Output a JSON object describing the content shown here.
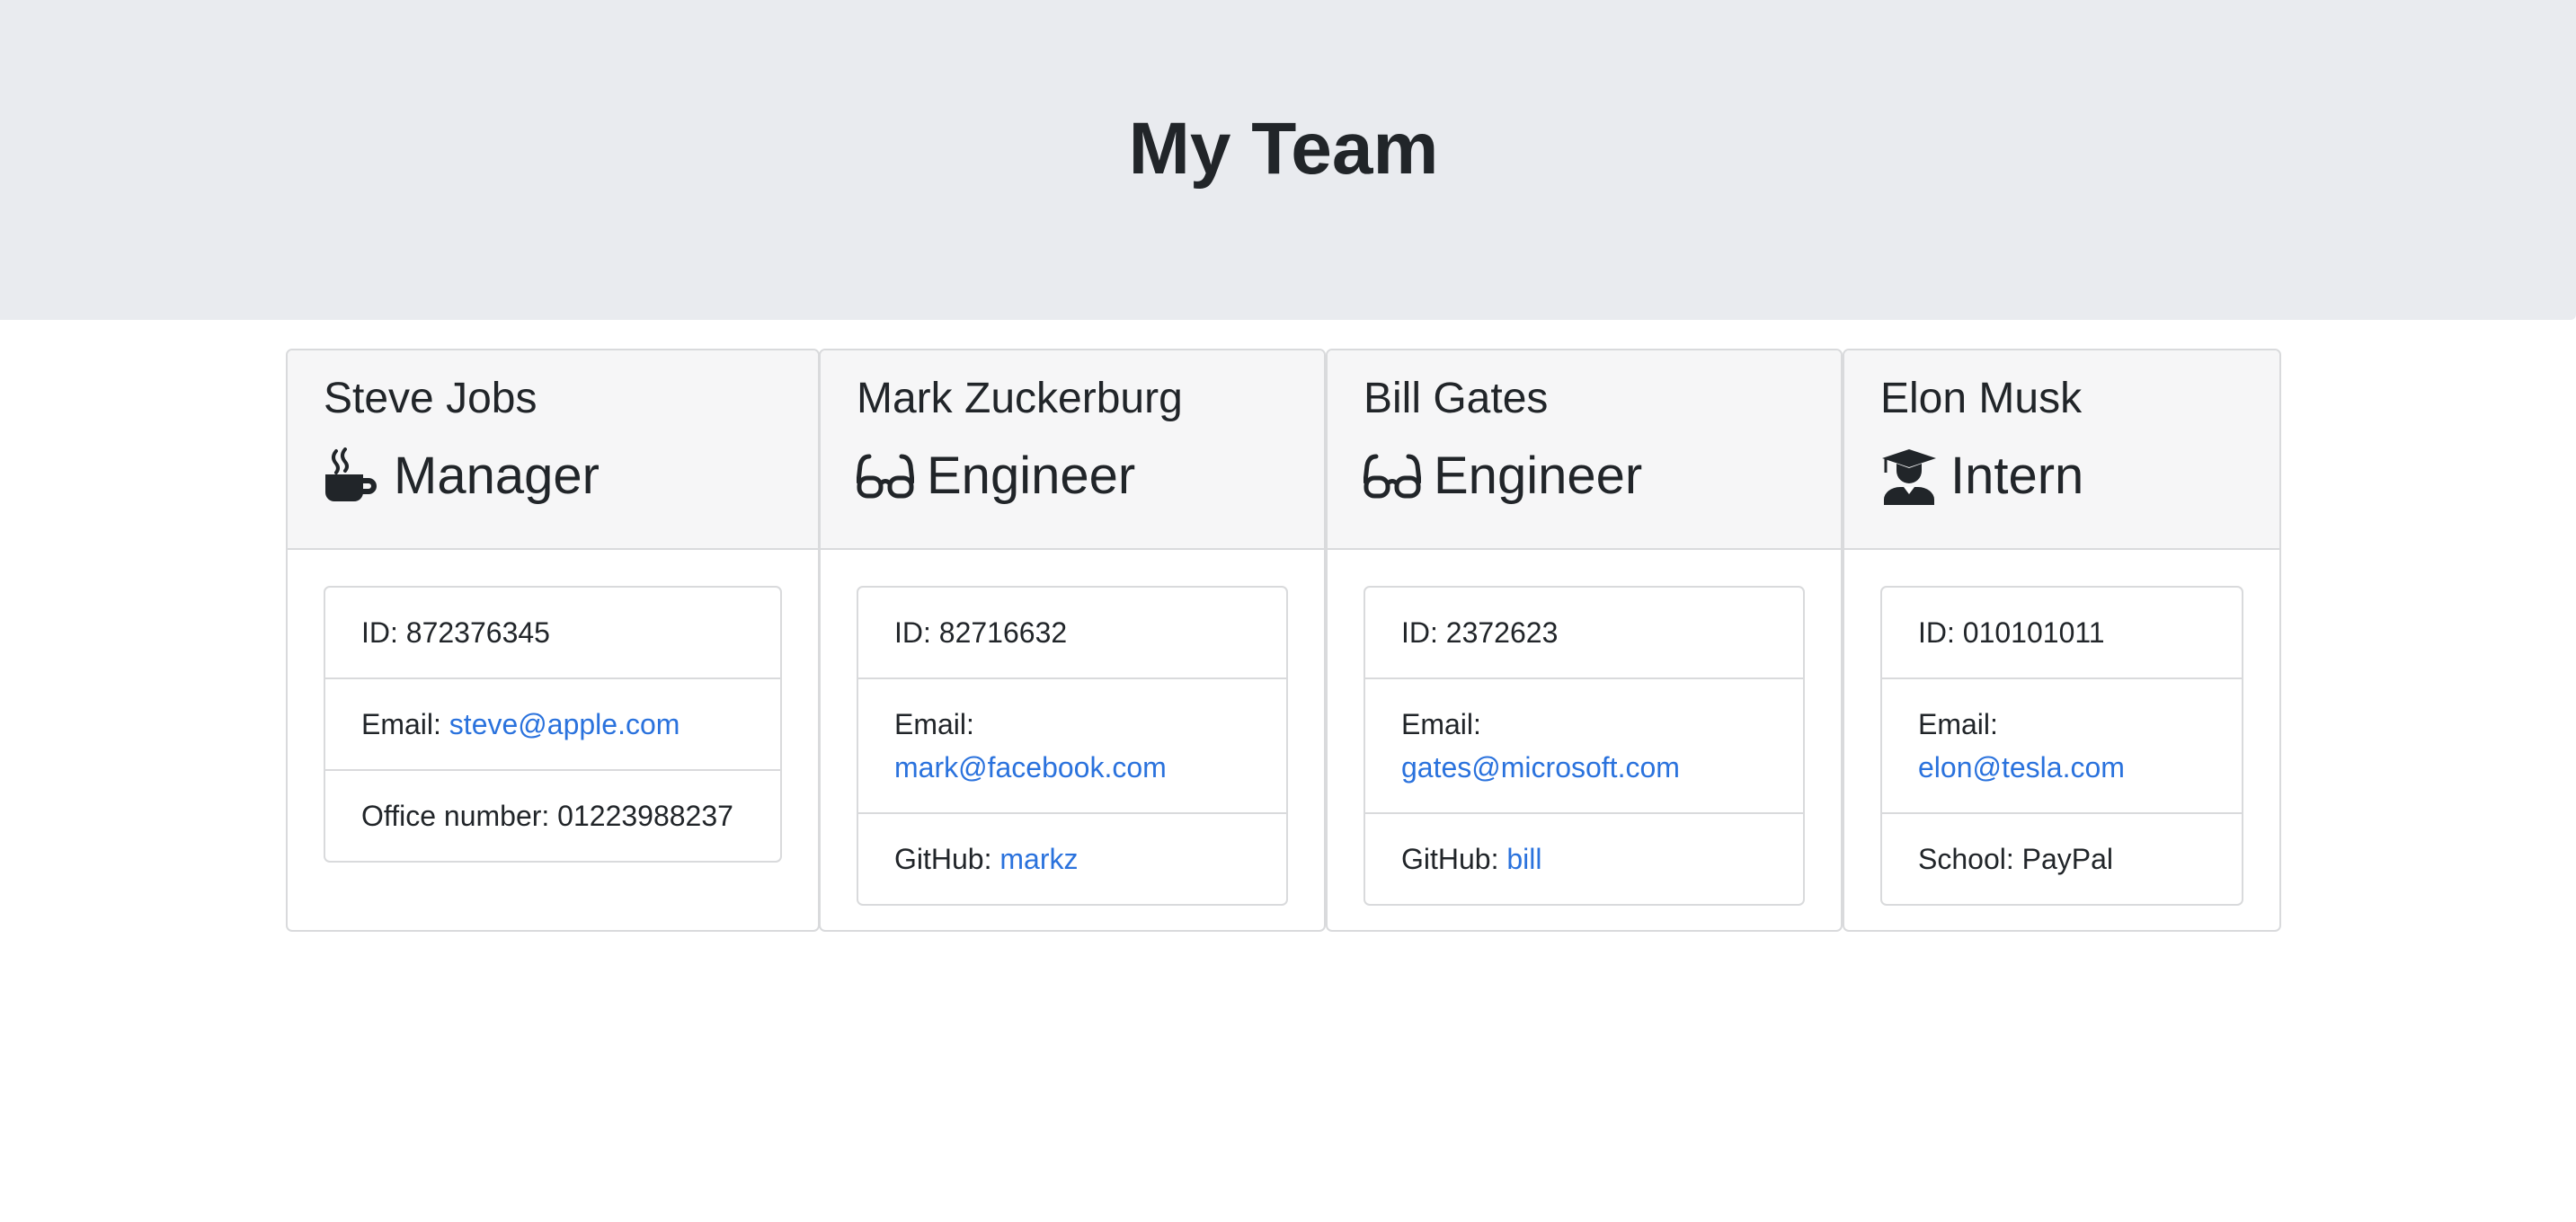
{
  "page": {
    "title": "My Team"
  },
  "colors": {
    "jumbotron_bg": "#e9ebef",
    "link": "#2a72dd",
    "text": "#212529",
    "card_header_bg": "#f6f6f7",
    "border": "#d9dadc"
  },
  "employees": [
    {
      "name": "Steve Jobs",
      "role": "Manager",
      "icon": "coffee-mug-icon",
      "id_label": "ID: ",
      "id": "872376345",
      "email_label": "Email: ",
      "email": "steve@apple.com",
      "extra_label": "Office number: ",
      "extra_value": "01223988237"
    },
    {
      "name": "Mark Zuckerburg",
      "role": "Engineer",
      "icon": "glasses-icon",
      "id_label": "ID: ",
      "id": "82716632",
      "email_label": "Email: ",
      "email": "mark@facebook.com",
      "extra_label": "GitHub: ",
      "extra_value": "markz"
    },
    {
      "name": "Bill Gates",
      "role": "Engineer",
      "icon": "glasses-icon",
      "id_label": "ID: ",
      "id": "2372623",
      "email_label": "Email: ",
      "email": "gates@microsoft.com",
      "extra_label": "GitHub: ",
      "extra_value": "bill"
    },
    {
      "name": "Elon Musk",
      "role": "Intern",
      "icon": "graduate-icon",
      "id_label": "ID: ",
      "id": "010101011",
      "email_label": "Email: ",
      "email": "elon@tesla.com",
      "extra_label": "School: ",
      "extra_value": "PayPal"
    }
  ]
}
